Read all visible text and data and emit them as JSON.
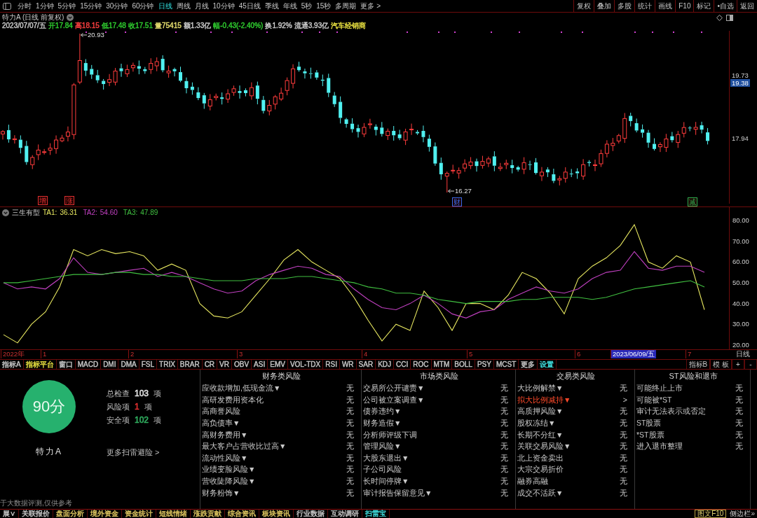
{
  "toolbar": {
    "periods": [
      {
        "label": "分时",
        "selected": false
      },
      {
        "label": "1分钟",
        "selected": false
      },
      {
        "label": "5分钟",
        "selected": false
      },
      {
        "label": "15分钟",
        "selected": false
      },
      {
        "label": "30分钟",
        "selected": false
      },
      {
        "label": "60分钟",
        "selected": false
      },
      {
        "label": "日线",
        "selected": true
      },
      {
        "label": "周线",
        "selected": false
      },
      {
        "label": "月线",
        "selected": false
      },
      {
        "label": "10分钟",
        "selected": false
      },
      {
        "label": "45日线",
        "selected": false
      },
      {
        "label": "季线",
        "selected": false
      },
      {
        "label": "年线",
        "selected": false
      },
      {
        "label": "5秒",
        "selected": false
      },
      {
        "label": "15秒",
        "selected": false
      },
      {
        "label": "多周期",
        "selected": false
      },
      {
        "label": "更多 >",
        "selected": false
      }
    ],
    "actions": [
      "复权",
      "叠加",
      "多股",
      "统计",
      "画线",
      "F10",
      "标记",
      "•自选",
      "返回"
    ]
  },
  "stock_header": {
    "title": "特力A (日线 前复权)"
  },
  "quote_line": [
    {
      "text": "2023/07/07/五",
      "color": "#d0d0d0"
    },
    {
      "text": "开17.84",
      "color": "#30d030"
    },
    {
      "text": "高18.15",
      "color": "#ff4040"
    },
    {
      "text": "低17.48",
      "color": "#30d030"
    },
    {
      "text": "收17.51",
      "color": "#30d030"
    },
    {
      "text": "量75415",
      "color": "#e8e070"
    },
    {
      "text": "额1.33亿",
      "color": "#d0d0d0"
    },
    {
      "text": "幅-0.43(-2.40%)",
      "color": "#30d030"
    },
    {
      "text": "换1.92%",
      "color": "#d0d0d0"
    },
    {
      "text": "流通3.93亿",
      "color": "#d0d0d0"
    },
    {
      "text": "汽车经销商",
      "color": "#e8e040"
    }
  ],
  "price_chart": {
    "high_label": "20.93",
    "low_label": "16.27",
    "event_markers": [
      {
        "text": "增",
        "color": "#e03030"
      },
      {
        "text": "涨",
        "color": "#e03030"
      },
      {
        "text": "财",
        "color": "#3a6ae8"
      },
      {
        "text": "减",
        "color": "#30b050"
      }
    ],
    "axis_labels": [
      {
        "text": "19.73",
        "highlighted": false
      },
      {
        "text": "19.38",
        "highlighted": true
      },
      {
        "text": "17.94",
        "highlighted": false
      }
    ]
  },
  "indicator_panel": {
    "title": "三生有型",
    "readouts": [
      {
        "value": "36.31"
      },
      {
        "value": "54.60"
      },
      {
        "value": "47.89"
      }
    ],
    "chart_data": {
      "type": "line",
      "categories": [
        null,
        null,
        null,
        null,
        null,
        null,
        null,
        null,
        null,
        null,
        null,
        null,
        null,
        null,
        null,
        null,
        null,
        null,
        null,
        null,
        null,
        null,
        null,
        null,
        null,
        null,
        null,
        null,
        null,
        null,
        null,
        null,
        null,
        null,
        null,
        null,
        null,
        null,
        null,
        null,
        null,
        null,
        null,
        null,
        null,
        null,
        null,
        null,
        null,
        null,
        null
      ],
      "ylim": [
        17.6,
        86.4
      ],
      "yticks": [
        {
          "value": 80,
          "label": "80.00"
        },
        {
          "value": 70,
          "label": "70.00"
        },
        {
          "value": 60,
          "label": "60.00"
        },
        {
          "value": 50,
          "label": "50.00"
        },
        {
          "value": 40,
          "label": "40.00"
        },
        {
          "value": 30,
          "label": "30.00"
        },
        {
          "value": 20,
          "label": "20.00"
        }
      ],
      "series": [
        {
          "name": "TA1:",
          "color": "#e8e860",
          "values": [
            25,
            21,
            30,
            36,
            48,
            66,
            63,
            66,
            64,
            65,
            63,
            56,
            59,
            56,
            40,
            34,
            33,
            36,
            44,
            52,
            61,
            66,
            60,
            56,
            52,
            43,
            32,
            22,
            30,
            27,
            46,
            38,
            27,
            40,
            40,
            37,
            44,
            55,
            52,
            45,
            35,
            52,
            58,
            62,
            68,
            78,
            60,
            57,
            63,
            60,
            37
          ]
        },
        {
          "name": "TA2:",
          "color": "#c040c0",
          "values": [
            50,
            47,
            48,
            47,
            52,
            62,
            55,
            54,
            55,
            56,
            57,
            53,
            55,
            53,
            50,
            47,
            45,
            46,
            51,
            54,
            56,
            58,
            57,
            54,
            53,
            47,
            42,
            38,
            37,
            40,
            44,
            40,
            35,
            33,
            36,
            37,
            42,
            45,
            48,
            46,
            45,
            47,
            52,
            55,
            56,
            65,
            57,
            56,
            58,
            58,
            55
          ]
        },
        {
          "name": "TA3:",
          "color": "#40c040",
          "values": [
            50,
            50,
            51,
            52,
            53,
            54,
            54,
            54,
            55,
            55,
            54,
            54,
            53,
            53,
            52,
            51,
            51,
            51,
            52,
            52,
            52,
            53,
            53,
            52,
            51,
            50,
            48,
            47,
            45,
            45,
            44,
            42,
            41,
            40,
            41,
            41,
            41,
            42,
            42,
            43,
            43,
            43,
            42,
            43,
            45,
            47,
            48,
            49,
            50,
            51,
            48
          ]
        }
      ]
    }
  },
  "date_axis": {
    "labels": [
      {
        "text": "2022年",
        "highlighted": false
      },
      {
        "text": "1",
        "highlighted": false
      },
      {
        "text": "2",
        "highlighted": false
      },
      {
        "text": "3",
        "highlighted": false
      },
      {
        "text": "4",
        "highlighted": false
      },
      {
        "text": "5",
        "highlighted": false
      },
      {
        "text": "6",
        "highlighted": false
      },
      {
        "text": "2023/06/09/五",
        "highlighted": true
      },
      {
        "text": "7",
        "highlighted": false
      }
    ],
    "period": "日线"
  },
  "indicator_tabs": {
    "items": [
      {
        "label": "指标A",
        "color": "#c8c8c8"
      },
      {
        "label": "指标平台",
        "color": "#e8e040"
      },
      {
        "label": "窗口",
        "color": "#c8c8c8"
      },
      {
        "label": "MACD",
        "color": "#c8c8c8"
      },
      {
        "label": "DMI",
        "color": "#c8c8c8"
      },
      {
        "label": "DMA",
        "color": "#c8c8c8"
      },
      {
        "label": "FSL",
        "color": "#c8c8c8"
      },
      {
        "label": "TRIX",
        "color": "#c8c8c8"
      },
      {
        "label": "BRAR",
        "color": "#c8c8c8"
      },
      {
        "label": "CR",
        "color": "#c8c8c8"
      },
      {
        "label": "VR",
        "color": "#c8c8c8"
      },
      {
        "label": "OBV",
        "color": "#c8c8c8"
      },
      {
        "label": "ASI",
        "color": "#c8c8c8"
      },
      {
        "label": "EMV",
        "color": "#c8c8c8"
      },
      {
        "label": "VOL-TDX",
        "color": "#c8c8c8"
      },
      {
        "label": "RSI",
        "color": "#c8c8c8"
      },
      {
        "label": "WR",
        "color": "#c8c8c8"
      },
      {
        "label": "SAR",
        "color": "#c8c8c8"
      },
      {
        "label": "KDJ",
        "color": "#c8c8c8"
      },
      {
        "label": "CCI",
        "color": "#c8c8c8"
      },
      {
        "label": "ROC",
        "color": "#c8c8c8"
      },
      {
        "label": "MTM",
        "color": "#c8c8c8"
      },
      {
        "label": "BOLL",
        "color": "#c8c8c8"
      },
      {
        "label": "PSY",
        "color": "#c8c8c8"
      },
      {
        "label": "MCST",
        "color": "#c8c8c8"
      },
      {
        "label": "更多",
        "color": "#c8c8c8"
      },
      {
        "label": "设置",
        "color": "#40e0e0"
      }
    ],
    "right": [
      "指标B",
      "模 板",
      "+",
      "-"
    ]
  },
  "risk_panel": {
    "score": "90分",
    "stock_name": "特力A",
    "stats": [
      {
        "label": "总检查",
        "count": "103",
        "unit": "项",
        "color": "#e0e0e0"
      },
      {
        "label": "风险项",
        "count": "1",
        "unit": "项",
        "color": "#e03030"
      },
      {
        "label": "安全项",
        "count": "102",
        "unit": "项",
        "color": "#30b060"
      }
    ],
    "more_link": "更多扫雷避险 >",
    "disclaimer": "于大数据评测,仅供参考",
    "columns": [
      {
        "title": "财务类风险",
        "rows": [
          {
            "label": "应收款增加,低现金流▼",
            "value": "无",
            "flagged": false
          },
          {
            "label": "高研发费用资本化",
            "value": "无",
            "flagged": false
          },
          {
            "label": "高商誉风险",
            "value": "无",
            "flagged": false
          },
          {
            "label": "高负债率▼",
            "value": "无",
            "flagged": false
          },
          {
            "label": "高财务费用▼",
            "value": "无",
            "flagged": false
          },
          {
            "label": "最大客户占营收比过高▼",
            "value": "无",
            "flagged": false
          },
          {
            "label": "流动性风险▼",
            "value": "无",
            "flagged": false
          },
          {
            "label": "业绩变脸风险▼",
            "value": "无",
            "flagged": false
          },
          {
            "label": "营收陡降风险▼",
            "value": "无",
            "flagged": false
          },
          {
            "label": "财务粉饰▼",
            "value": "无",
            "flagged": false
          }
        ]
      },
      {
        "title": "市场类风险",
        "rows": [
          {
            "label": "交易所公开谴责▼",
            "value": "无",
            "flagged": false
          },
          {
            "label": "公司被立案调查▼",
            "value": "无",
            "flagged": false
          },
          {
            "label": "债券违约▼",
            "value": "无",
            "flagged": false
          },
          {
            "label": "财务造假▼",
            "value": "无",
            "flagged": false
          },
          {
            "label": "分析师评级下调",
            "value": "无",
            "flagged": false
          },
          {
            "label": "管理风险▼",
            "value": "无",
            "flagged": false
          },
          {
            "label": "大股东退出▼",
            "value": "无",
            "flagged": false
          },
          {
            "label": "子公司风险",
            "value": "无",
            "flagged": false
          },
          {
            "label": "长时间停牌▼",
            "value": "无",
            "flagged": false
          },
          {
            "label": "审计报告保留意见▼",
            "value": "无",
            "flagged": false
          }
        ]
      },
      {
        "title": "交易类风险",
        "rows": [
          {
            "label": "大比例解禁▼",
            "value": "无",
            "flagged": false
          },
          {
            "label": "拟大比例减持▼",
            "value": ">",
            "flagged": true
          },
          {
            "label": "高质押风险▼",
            "value": "无",
            "flagged": false
          },
          {
            "label": "股权冻结▼",
            "value": "无",
            "flagged": false
          },
          {
            "label": "长期不分红▼",
            "value": "无",
            "flagged": false
          },
          {
            "label": "关联交易风险▼",
            "value": "无",
            "flagged": false
          },
          {
            "label": "北上资金卖出",
            "value": "无",
            "flagged": false
          },
          {
            "label": "大宗交易折价",
            "value": "无",
            "flagged": false
          },
          {
            "label": "融券高融",
            "value": "无",
            "flagged": false
          },
          {
            "label": "成交不活跃▼",
            "value": "无",
            "flagged": false
          }
        ]
      },
      {
        "title": "ST风险和退市",
        "rows": [
          {
            "label": "可能终止上市",
            "value": "无",
            "flagged": false
          },
          {
            "label": "可能被*ST",
            "value": "无",
            "flagged": false
          },
          {
            "label": "审计无法表示或否定",
            "value": "无",
            "flagged": false
          },
          {
            "label": "ST股票",
            "value": "无",
            "flagged": false
          },
          {
            "label": "*ST股票",
            "value": "无",
            "flagged": false
          },
          {
            "label": "进入退市整理",
            "value": "无",
            "flagged": false
          }
        ]
      }
    ]
  },
  "bottom_tabs": {
    "items": [
      {
        "label": "展∨",
        "color": "#c8c8c8"
      },
      {
        "label": "关联报价",
        "color": "#c8c8c8"
      },
      {
        "label": "盘面分析",
        "color": "#e0c860"
      },
      {
        "label": "境外资金",
        "color": "#e0c860"
      },
      {
        "label": "资金统计",
        "color": "#e0c860"
      },
      {
        "label": "短线情绪",
        "color": "#e0c860"
      },
      {
        "label": "涨跌贡献",
        "color": "#e0c860"
      },
      {
        "label": "综合资讯",
        "color": "#e0c860"
      },
      {
        "label": "板块资讯",
        "color": "#e0c860"
      },
      {
        "label": "行业数据",
        "color": "#c8c8c8"
      },
      {
        "label": "互动调研",
        "color": "#c8c8c8"
      },
      {
        "label": "扫雷宝",
        "color": "#40e0e0"
      }
    ],
    "right": [
      {
        "label": "图文F10",
        "kind": "boxed"
      },
      {
        "label": "侧边栏»",
        "kind": "plain"
      }
    ]
  }
}
